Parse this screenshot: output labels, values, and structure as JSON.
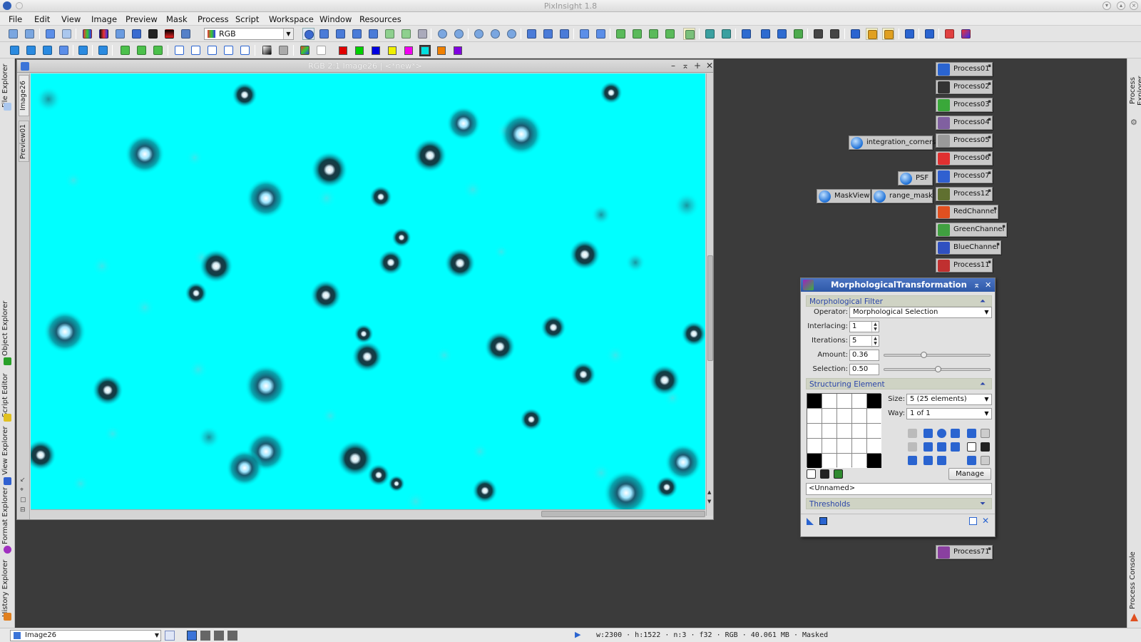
{
  "app": {
    "title": "PixInsight 1.8"
  },
  "menu": [
    "File",
    "Edit",
    "View",
    "Image",
    "Preview",
    "Mask",
    "Process",
    "Script",
    "Workspace",
    "Window",
    "Resources"
  ],
  "toolbar": {
    "channel_combo": "RGB"
  },
  "left_dock": {
    "tabs": [
      "File Explorer",
      "Object Explorer",
      "Script Editor",
      "View Explorer",
      "Format Explorer",
      "History Explorer"
    ]
  },
  "right_dock": {
    "tabs": [
      "Process Explorer",
      "Process Console"
    ]
  },
  "image_window": {
    "title": "RGB 2:1 Image26 | <*new*>",
    "tabs": [
      "Image26",
      "Preview01"
    ],
    "background_color": "#00ffff"
  },
  "process_icons": [
    {
      "label": "Process01",
      "color": "#2a64d0"
    },
    {
      "label": "Process02",
      "color": "#333333"
    },
    {
      "label": "Process03",
      "color": "#3aa83a"
    },
    {
      "label": "Process04",
      "color": "#8060a0"
    },
    {
      "label": "Process05",
      "color": "#9a9a9a"
    },
    {
      "label": "Process06",
      "color": "#e03030"
    },
    {
      "label": "Process07",
      "color": "#3060d0"
    },
    {
      "label": "Process12",
      "color": "#607030"
    },
    {
      "label": "RedChannel",
      "color": "#e05020"
    },
    {
      "label": "GreenChannel",
      "color": "#40a040"
    },
    {
      "label": "BlueChannel",
      "color": "#3050c0"
    },
    {
      "label": "Process11",
      "color": "#c03030"
    },
    {
      "label": "Process71",
      "color": "#8a40a0"
    }
  ],
  "instance_icons": [
    {
      "label": "integration_corners"
    },
    {
      "label": "PSF"
    },
    {
      "label": "MaskView"
    },
    {
      "label": "range_mask"
    }
  ],
  "morph": {
    "title": "MorphologicalTransformation",
    "section_filter": "Morphological Filter",
    "operator_label": "Operator:",
    "operator_value": "Morphological Selection",
    "interlacing_label": "Interlacing:",
    "interlacing_value": "1",
    "iterations_label": "Iterations:",
    "iterations_value": "5",
    "amount_label": "Amount:",
    "amount_value": "0.36",
    "amount_fraction": 0.36,
    "selection_label": "Selection:",
    "selection_value": "0.50",
    "selection_fraction": 0.5,
    "section_struct": "Structuring Element",
    "size_label": "Size:",
    "size_value": "5  (25 elements)",
    "way_label": "Way:",
    "way_value": "1 of 1",
    "grid": [
      1,
      0,
      0,
      0,
      1,
      0,
      0,
      0,
      0,
      0,
      0,
      0,
      0,
      0,
      0,
      0,
      0,
      0,
      0,
      0,
      1,
      0,
      0,
      0,
      1
    ],
    "manage_label": "Manage",
    "name_value": "<Unnamed>",
    "section_thresholds": "Thresholds"
  },
  "status": {
    "view_combo": "Image26",
    "info": "w:2300  ·  h:1522  ·  n:3  ·  f32  ·  RGB  ·  40.061 MB  ·  Masked"
  }
}
